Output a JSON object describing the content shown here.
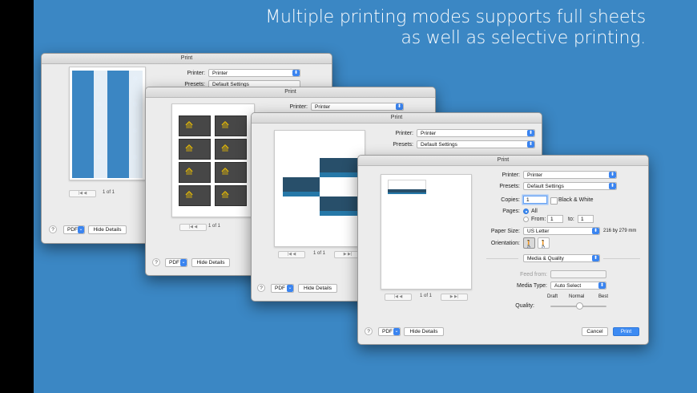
{
  "tagline": {
    "line1": "Multiple printing modes supports full sheets",
    "line2": "as well as selective printing."
  },
  "common": {
    "window_title": "Print",
    "printer_label": "Printer:",
    "printer_value": "Printer",
    "presets_label": "Presets:",
    "presets_value": "Default Settings",
    "pdf_label": "PDF",
    "hide_details_label": "Hide Details",
    "help_label": "?",
    "page_indicator": "1 of 1",
    "pager_prev": "|◀  ◀",
    "pager_next": "▶  ▶|",
    "popup_arrow": "⬍",
    "pdf_arrow": "⌄"
  },
  "front": {
    "copies_label": "Copies:",
    "copies_value": "1",
    "bw_label": "Black & White",
    "pages_label": "Pages:",
    "pages_all": "All",
    "pages_from": "From:",
    "pages_from_value": "1",
    "pages_to": "to:",
    "pages_to_value": "1",
    "paper_size_label": "Paper Size:",
    "paper_size_value": "US Letter",
    "paper_size_dims": "216 by 279 mm",
    "orientation_label": "Orientation:",
    "orientation_portrait_icon": "🚶",
    "orientation_landscape_icon": "🚶",
    "section_value": "Media & Quality",
    "feed_label": "Feed from:",
    "feed_value": "",
    "media_type_label": "Media Type:",
    "media_type_value": "Auto Select",
    "quality_draft": "Draft",
    "quality_normal": "Normal",
    "quality_best": "Best",
    "quality_label": "Quality:",
    "quality_level": 0.5,
    "cancel_label": "Cancel",
    "print_label": "Print"
  },
  "colors": {
    "background": "#3b87c4",
    "accent": "#3d8bf3",
    "card_dark": "#474747",
    "card_logo": "#f2c300"
  },
  "icons": {
    "snowflake": "❄",
    "wheat_logo": "⟰"
  }
}
